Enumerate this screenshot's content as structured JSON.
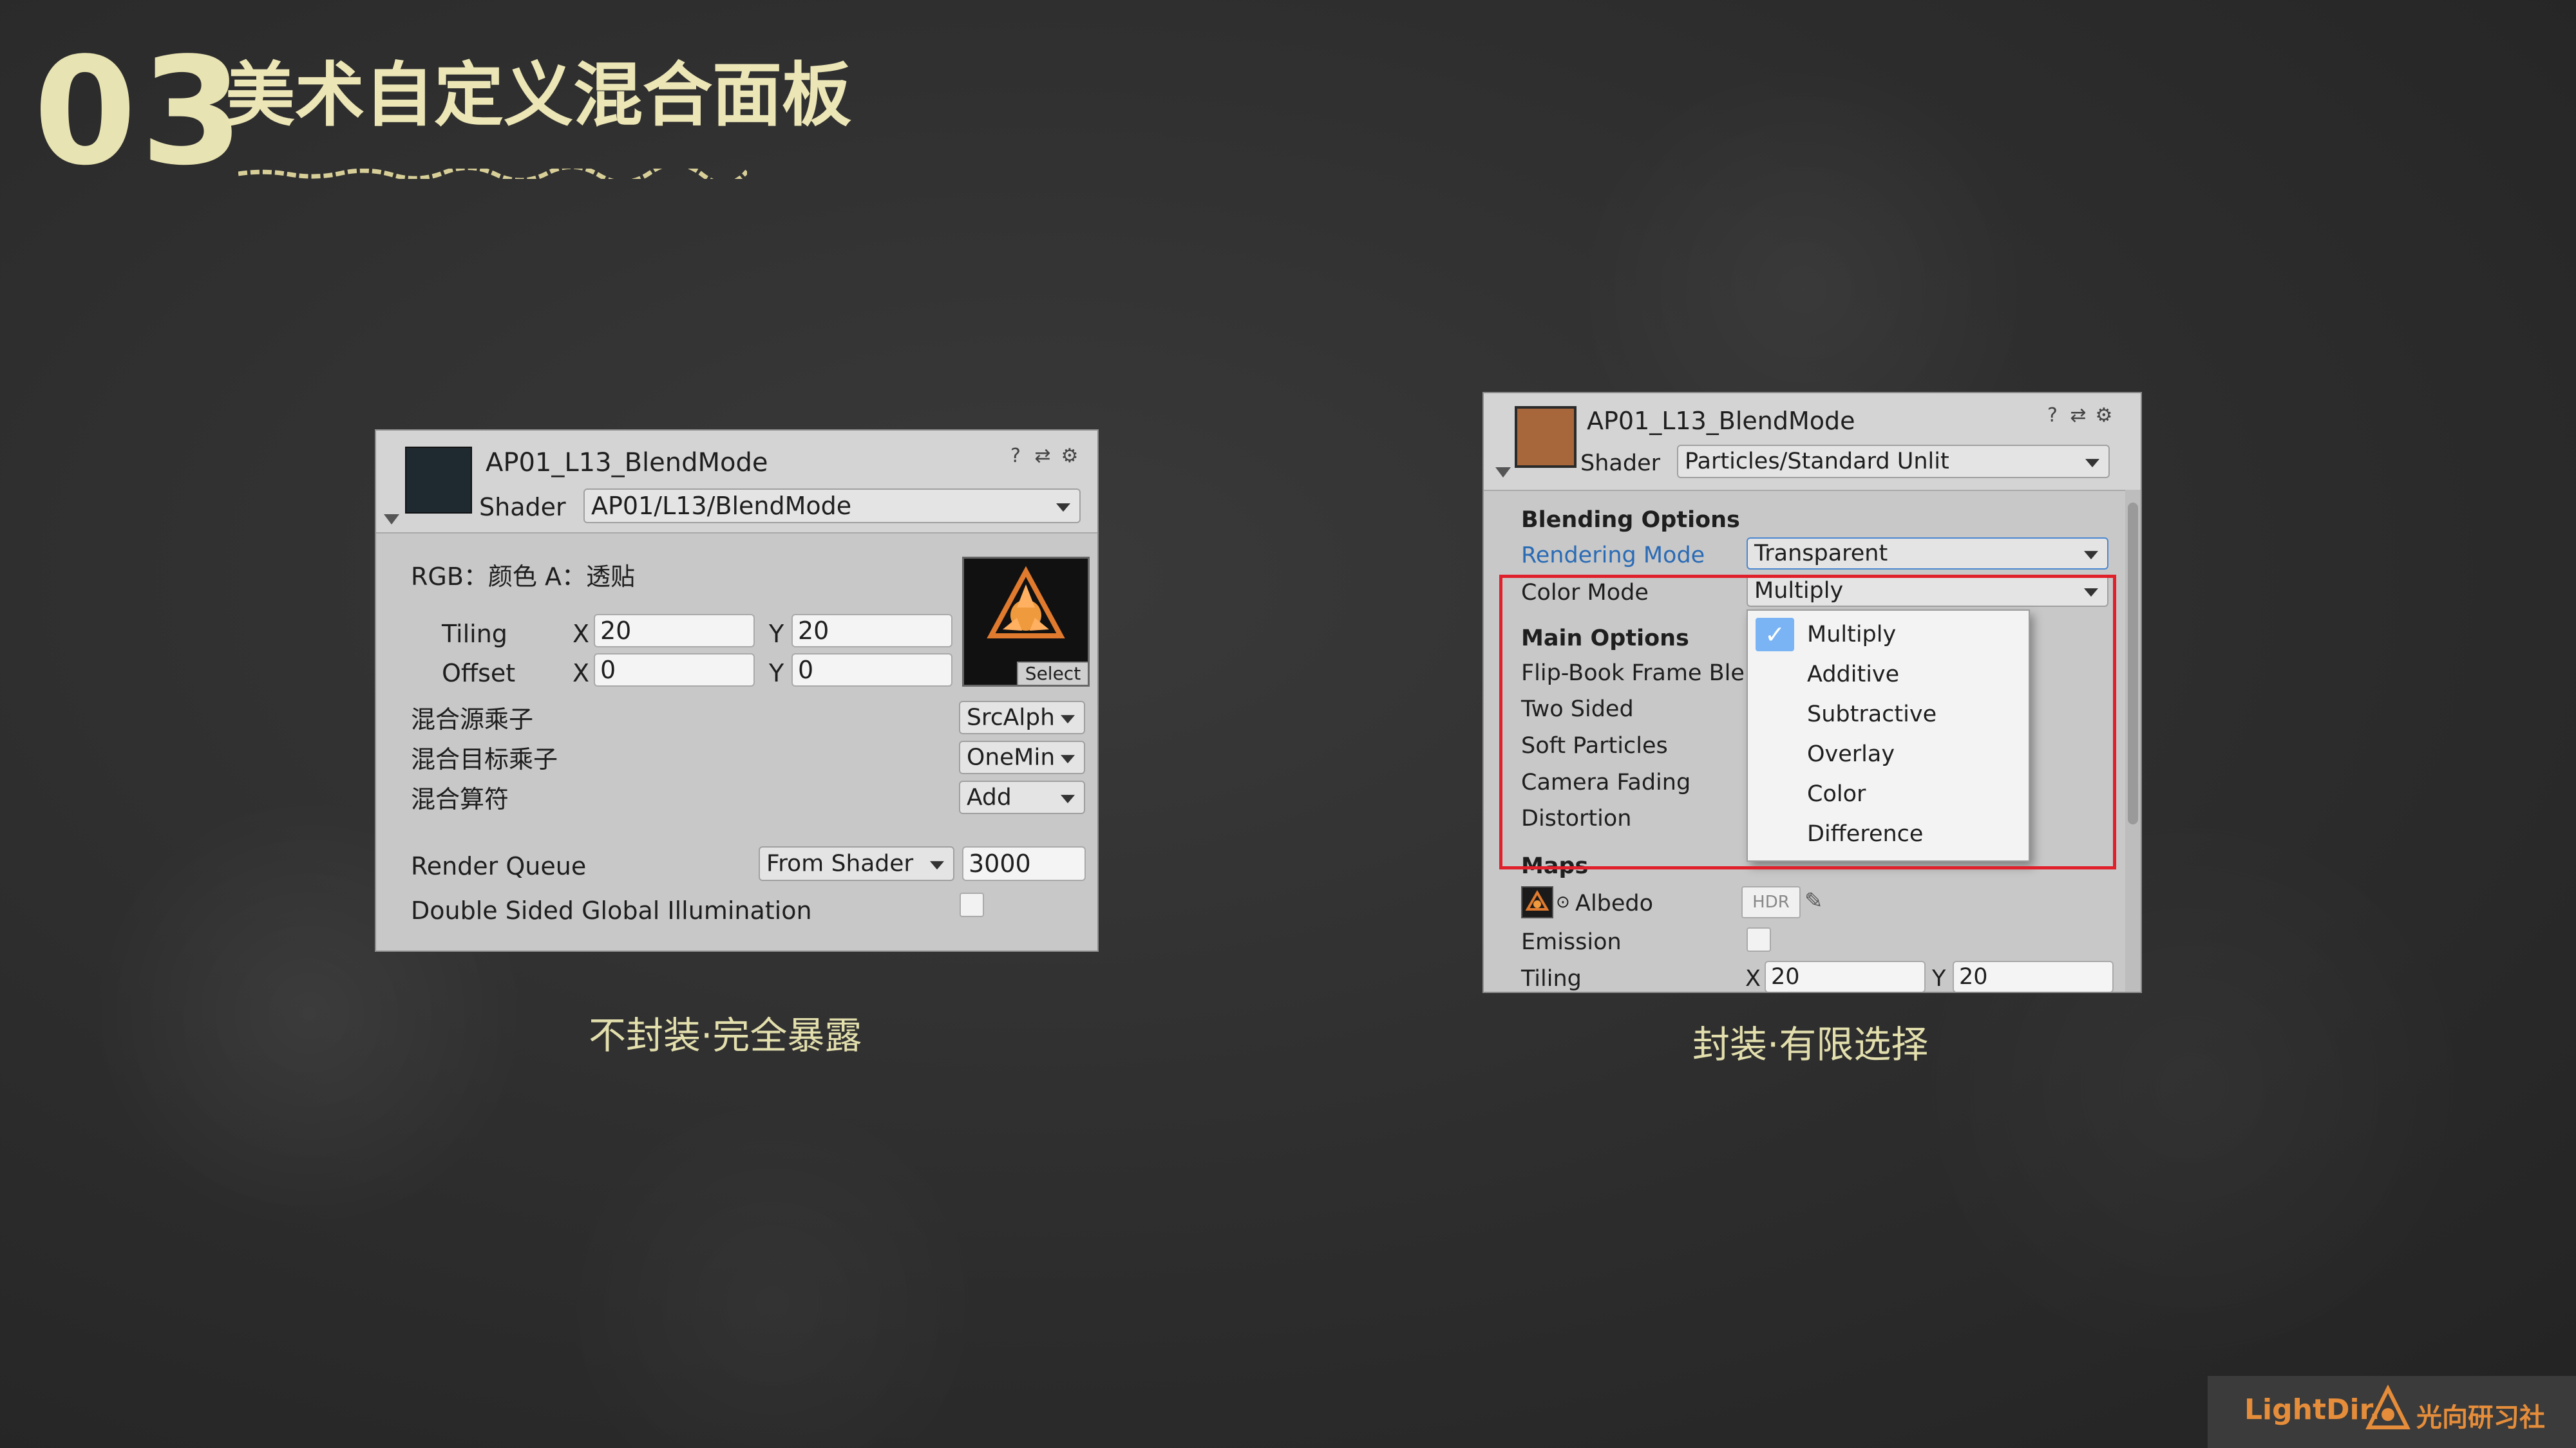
{
  "slide": {
    "number": "03",
    "title": "美术自定义混合面板"
  },
  "left_panel": {
    "material_name": "AP01_L13_BlendMode",
    "shader_label": "Shader",
    "shader_value": "AP01/L13/BlendMode",
    "texture_label": "RGB：颜色 A：透贴",
    "select_label": "Select",
    "tiling_label": "Tiling",
    "offset_label": "Offset",
    "x_label": "X",
    "y_label": "Y",
    "tiling_x": "20",
    "tiling_y": "20",
    "offset_x": "0",
    "offset_y": "0",
    "src_factor_label": "混合源乘子",
    "src_factor_value": "SrcAlph",
    "dst_factor_label": "混合目标乘子",
    "dst_factor_value": "OneMin",
    "blend_op_label": "混合算符",
    "blend_op_value": "Add",
    "render_queue_label": "Render Queue",
    "render_queue_mode": "From Shader",
    "render_queue_value": "3000",
    "double_sided_gi_label": "Double Sided Global Illumination",
    "caption": "不封装·完全暴露"
  },
  "right_panel": {
    "material_name": "AP01_L13_BlendMode",
    "shader_label": "Shader",
    "shader_value": "Particles/Standard Unlit",
    "blending_options": "Blending Options",
    "rendering_mode_label": "Rendering Mode",
    "rendering_mode_value": "Transparent",
    "color_mode_label": "Color Mode",
    "color_mode_value": "Multiply",
    "main_options": "Main Options",
    "flipbook_label": "Flip-Book Frame Blen",
    "two_sided_label": "Two Sided",
    "soft_particles_label": "Soft Particles",
    "camera_fading_label": "Camera Fading",
    "distortion_label": "Distortion",
    "maps_label": "Maps",
    "albedo_label": "Albedo",
    "hdr_label": "HDR",
    "emission_label": "Emission",
    "tiling_label": "Tiling",
    "x_label": "X",
    "y_label": "Y",
    "tiling_x": "20",
    "tiling_y": "20",
    "menu_items": [
      "Multiply",
      "Additive",
      "Subtractive",
      "Overlay",
      "Color",
      "Difference"
    ],
    "menu_selected": "Multiply",
    "caption": "封装·有限选择"
  },
  "watermark": {
    "brand": "LightDir.",
    "brand_cn": "光向研习社"
  },
  "colors": {
    "chalk_yellow": "#ece6b6",
    "highlight_red": "#e0202a",
    "link_blue": "#2a6bb5",
    "check_blue": "#7ab4f5",
    "brand_orange": "#e58d3a"
  }
}
